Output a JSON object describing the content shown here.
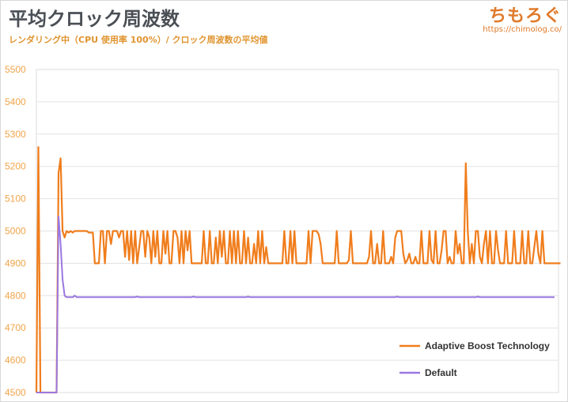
{
  "header": {
    "title": "平均クロック周波数",
    "subtitle": "レンダリング中（CPU 使用率 100%）/ クロック周波数の平均値"
  },
  "logo": {
    "name": "ちもろぐ",
    "url": "https://chimolog.co/"
  },
  "colors": {
    "adaptive": "#f07d1c",
    "default": "#9a78e0",
    "tick": "#f0a44a",
    "grid": "#e3e3e3"
  },
  "chart_data": {
    "type": "line",
    "title": "平均クロック周波数",
    "ylim": [
      4500,
      5500
    ],
    "yticks": [
      4500,
      4600,
      4700,
      4800,
      4900,
      5000,
      5100,
      5200,
      5300,
      5400,
      5500
    ],
    "grid": true,
    "legend_position": "bottom-right",
    "x_count": 260,
    "series": [
      {
        "name": "Adaptive Boost Technology",
        "color": "#f07d1c",
        "values": [
          4500,
          5260,
          4500,
          4500,
          4500,
          4500,
          4500,
          4500,
          4500,
          4500,
          4500,
          5180,
          5225,
          5000,
          4980,
          5000,
          4995,
          5000,
          4995,
          5000,
          5000,
          5000,
          5000,
          5000,
          5000,
          5000,
          4995,
          4995,
          4995,
          4900,
          4900,
          4900,
          5000,
          5000,
          4900,
          5000,
          5000,
          4960,
          5000,
          5000,
          5000,
          4980,
          5000,
          5000,
          4920,
          5000,
          4910,
          5000,
          4900,
          5000,
          4900,
          4950,
          5000,
          5000,
          4920,
          5000,
          4980,
          4900,
          5000,
          4920,
          5000,
          4900,
          4900,
          5000,
          4930,
          5000,
          4900,
          4900,
          5000,
          5000,
          4980,
          4900,
          5000,
          4900,
          5000,
          4940,
          5000,
          4900,
          4900,
          4900,
          4900,
          4900,
          4900,
          5000,
          4900,
          4900,
          5000,
          4900,
          4900,
          4980,
          4900,
          5000,
          4920,
          5000,
          4900,
          4900,
          5000,
          4900,
          5000,
          4900,
          5000,
          4900,
          4900,
          5000,
          4900,
          4980,
          4900,
          4900,
          4960,
          4900,
          5000,
          4900,
          5000,
          4900,
          4950,
          4900,
          4900,
          4900,
          4900,
          4900,
          4900,
          4900,
          4900,
          5000,
          4900,
          4900,
          5000,
          4900,
          5000,
          4900,
          4900,
          4900,
          4900,
          4900,
          4900,
          5000,
          4900,
          5000,
          5000,
          5000,
          4990,
          4960,
          4900,
          4900,
          4900,
          4900,
          4900,
          4900,
          4900,
          5000,
          4900,
          4900,
          4900,
          4900,
          4900,
          4910,
          5000,
          4900,
          4900,
          4900,
          4900,
          4900,
          4900,
          4900,
          4900,
          4920,
          5000,
          4900,
          4900,
          4960,
          4900,
          4900,
          5000,
          4900,
          4900,
          4900,
          4920,
          4900,
          4980,
          5000,
          5000,
          5000,
          4930,
          4900,
          4910,
          4930,
          4900,
          4900,
          4920,
          4900,
          4900,
          5000,
          4900,
          4900,
          4900,
          5000,
          4910,
          4900,
          5000,
          4900,
          4900,
          4940,
          5000,
          5000,
          4900,
          4920,
          4900,
          4900,
          5000,
          4930,
          4960,
          4900,
          4900,
          5210,
          5000,
          4900,
          4960,
          4900,
          5000,
          5000,
          4920,
          4900,
          4960,
          5000,
          4900,
          5000,
          4900,
          4900,
          5000,
          4940,
          4900,
          4900,
          4900,
          5000,
          4900,
          4900,
          4900,
          5000,
          4900,
          4900,
          4900,
          5000,
          4900,
          4900,
          5000,
          4900,
          4900,
          4950,
          5000,
          4930,
          4900,
          5000,
          4900,
          4900,
          4900,
          4900,
          4900,
          4900,
          4900,
          4900,
          4900
        ],
        "line_width": 2.2
      },
      {
        "name": "Default",
        "color": "#9a78e0",
        "values": [
          4500,
          4500,
          4500,
          4500,
          4500,
          4500,
          4500,
          4500,
          4500,
          4500,
          4500,
          5045,
          4960,
          4850,
          4800,
          4795,
          4795,
          4795,
          4795,
          4800,
          4795,
          4795,
          4795,
          4795,
          4795,
          4795,
          4795,
          4795,
          4795,
          4795,
          4795,
          4795,
          4795,
          4795,
          4795,
          4795,
          4795,
          4795,
          4795,
          4795,
          4795,
          4795,
          4795,
          4795,
          4795,
          4795,
          4795,
          4795,
          4795,
          4795,
          4797,
          4795,
          4795,
          4795,
          4795,
          4795,
          4795,
          4795,
          4795,
          4795,
          4795,
          4795,
          4795,
          4795,
          4795,
          4795,
          4795,
          4795,
          4795,
          4795,
          4795,
          4795,
          4795,
          4795,
          4795,
          4795,
          4795,
          4795,
          4797,
          4795,
          4795,
          4795,
          4795,
          4795,
          4795,
          4795,
          4795,
          4795,
          4795,
          4795,
          4795,
          4795,
          4795,
          4795,
          4795,
          4795,
          4795,
          4795,
          4795,
          4795,
          4795,
          4795,
          4795,
          4795,
          4795,
          4797,
          4795,
          4795,
          4795,
          4795,
          4795,
          4795,
          4795,
          4795,
          4795,
          4795,
          4795,
          4795,
          4795,
          4795,
          4795,
          4795,
          4795,
          4795,
          4795,
          4795,
          4795,
          4795,
          4795,
          4795,
          4795,
          4795,
          4795,
          4795,
          4795,
          4795,
          4795,
          4795,
          4795,
          4795,
          4795,
          4795,
          4795,
          4795,
          4795,
          4795,
          4795,
          4795,
          4795,
          4795,
          4795,
          4795,
          4795,
          4795,
          4795,
          4795,
          4795,
          4795,
          4795,
          4795,
          4795,
          4795,
          4795,
          4795,
          4795,
          4795,
          4795,
          4795,
          4795,
          4795,
          4795,
          4795,
          4795,
          4795,
          4795,
          4795,
          4795,
          4795,
          4795,
          4797,
          4795,
          4795,
          4795,
          4795,
          4795,
          4795,
          4795,
          4795,
          4795,
          4795,
          4795,
          4795,
          4795,
          4795,
          4795,
          4795,
          4795,
          4795,
          4795,
          4795,
          4795,
          4795,
          4795,
          4795,
          4795,
          4795,
          4795,
          4795,
          4795,
          4795,
          4795,
          4795,
          4795,
          4795,
          4795,
          4795,
          4795,
          4795,
          4795,
          4797,
          4795,
          4795,
          4795,
          4795,
          4795,
          4795,
          4795,
          4795,
          4795,
          4795,
          4795,
          4795,
          4795,
          4795,
          4795,
          4795,
          4795,
          4795,
          4795,
          4795,
          4795,
          4795,
          4795,
          4795,
          4795,
          4795,
          4795,
          4795,
          4795,
          4795,
          4795,
          4795,
          4795,
          4795,
          4795,
          4795,
          4795,
          4795
        ],
        "line_width": 2.0
      }
    ]
  }
}
